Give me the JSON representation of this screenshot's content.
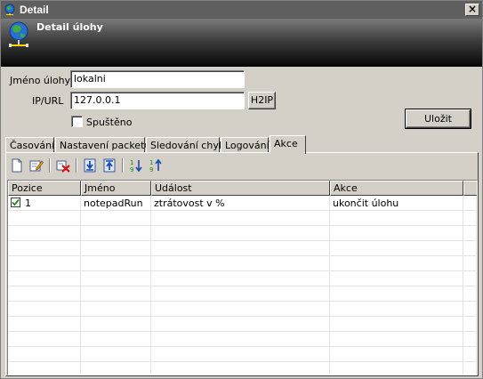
{
  "window": {
    "title": "Detail",
    "close_glyph": "×",
    "icon": "globe-icon"
  },
  "header": {
    "title": "Detail úlohy",
    "icon": "globe-network-icon"
  },
  "form": {
    "name_label": "Jméno úlohy",
    "name_value": "lokalni",
    "url_label": "IP/URL",
    "url_value": "127.0.0.1",
    "h2ip_label": "H2IP",
    "started_label": "Spuštěno",
    "started_checked": false,
    "save_label": "Uložit"
  },
  "tabs": [
    {
      "label": "Časování",
      "active": false
    },
    {
      "label": "Nastavení packetu",
      "active": false
    },
    {
      "label": "Sledování chyb",
      "active": false
    },
    {
      "label": "Logování",
      "active": false
    },
    {
      "label": "Akce",
      "active": true
    }
  ],
  "toolbar": {
    "icons": [
      "new-document-icon",
      "edit-icon",
      "delete-icon",
      "move-down-icon",
      "move-up-icon",
      "sort-ascending-icon",
      "sort-descending-icon"
    ]
  },
  "grid": {
    "columns": [
      "Pozice",
      "Jméno",
      "Událost",
      "Akce"
    ],
    "rows": [
      {
        "checked": true,
        "position": "1",
        "name": "notepadRun",
        "event": "ztrátovost v %",
        "action": "ukončit úlohu"
      }
    ]
  },
  "colors": {
    "accent_blue": "#2a5bb8",
    "check_green": "#1a8a1a"
  }
}
